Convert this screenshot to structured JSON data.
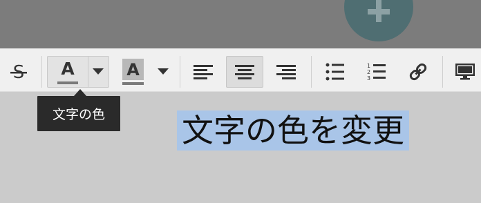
{
  "toolbar": {
    "buttons": [
      {
        "name": "strikethrough",
        "icon": "strikethrough-icon"
      },
      {
        "name": "text-color",
        "icon": "text-color-a-icon",
        "active": true
      },
      {
        "name": "text-color-dropdown",
        "icon": "caret-down-icon"
      },
      {
        "name": "background-color",
        "icon": "highlight-a-icon"
      },
      {
        "name": "background-color-dropdown",
        "icon": "caret-down-icon"
      },
      {
        "name": "align-left",
        "icon": "align-left-icon"
      },
      {
        "name": "align-center",
        "icon": "align-center-icon",
        "active": true
      },
      {
        "name": "align-right",
        "icon": "align-right-icon"
      },
      {
        "name": "bulleted-list",
        "icon": "bulleted-list-icon"
      },
      {
        "name": "numbered-list",
        "icon": "numbered-list-icon"
      },
      {
        "name": "link",
        "icon": "link-icon"
      },
      {
        "name": "preview",
        "icon": "monitor-icon"
      }
    ],
    "text_color_letter": "A",
    "background_color_letter": "A"
  },
  "tooltip": {
    "text": "文字の色"
  },
  "editor": {
    "selected_text": "文字の色を変更"
  },
  "colors": {
    "top_band": "#7c7c7c",
    "fab": "#4f6e72",
    "toolbar_bg": "#f0f0f0",
    "editor_bg": "#cbcbcb",
    "selection": "#a9c5e8",
    "tooltip_bg": "#2a2a2a"
  }
}
